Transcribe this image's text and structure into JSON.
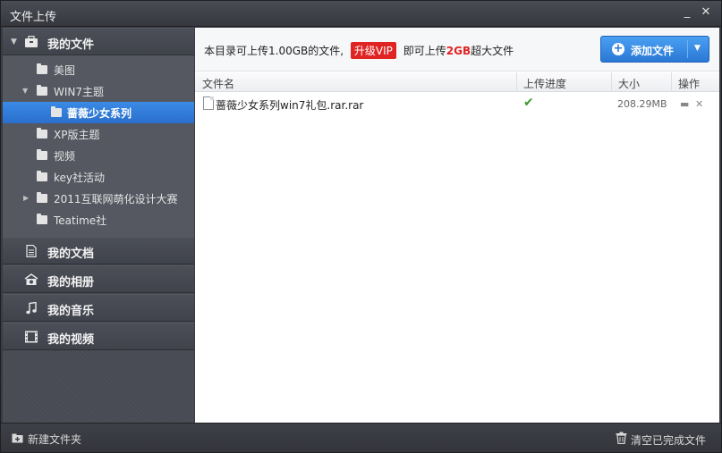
{
  "window": {
    "title": "文件上传",
    "minimize_label": "_",
    "close_label": "✕"
  },
  "sidebar": {
    "sections": [
      {
        "label": "我的文件",
        "icon": "briefcase-icon"
      },
      {
        "label": "我的文档",
        "icon": "document-icon"
      },
      {
        "label": "我的相册",
        "icon": "album-icon"
      },
      {
        "label": "我的音乐",
        "icon": "music-note-icon"
      },
      {
        "label": "我的视频",
        "icon": "film-icon"
      }
    ],
    "tree": [
      {
        "label": "美图"
      },
      {
        "label": "WIN7主题"
      },
      {
        "label": "蔷薇少女系列"
      },
      {
        "label": "XP版主题"
      },
      {
        "label": "视频"
      },
      {
        "label": "key社活动"
      },
      {
        "label": "2011互联网萌化设计大赛"
      },
      {
        "label": "Teatime社"
      }
    ]
  },
  "infobar": {
    "text_before": "本目录可上传1.00GB的文件,",
    "vip_label": "升级VIP",
    "text_middle": "即可上传",
    "highlight": "2GB",
    "text_after": "超大文件",
    "add_button_label": "添加文件"
  },
  "table": {
    "headers": [
      "文件名",
      "上传进度",
      "大小",
      "操作"
    ],
    "rows": [
      {
        "name": "蔷薇少女系列win7礼包.rar.rar",
        "status": "✔",
        "size": "208.29MB"
      }
    ]
  },
  "footer": {
    "new_folder_label": "新建文件夹",
    "clear_label": "清空已完成文件"
  }
}
